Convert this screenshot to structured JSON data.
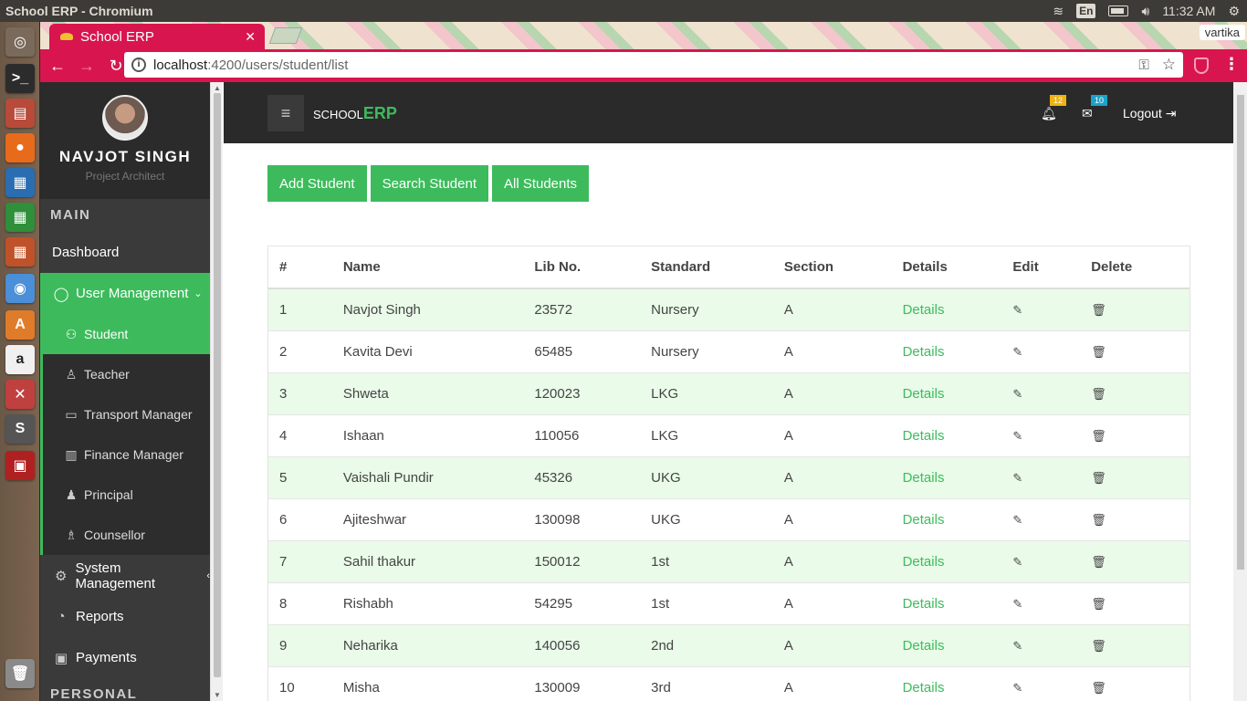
{
  "os": {
    "window_title": "School ERP - Chromium",
    "lang": "En",
    "time": "11:32 AM"
  },
  "launcher": [
    {
      "name": "dash-icon",
      "glyph": "◎",
      "color": "#7a6a5c"
    },
    {
      "name": "terminal-icon",
      "glyph": ">_",
      "color": "#2c2c2c"
    },
    {
      "name": "files-icon",
      "glyph": "▤",
      "color": "#b84a3a"
    },
    {
      "name": "firefox-icon",
      "glyph": "●",
      "color": "#e86b1c"
    },
    {
      "name": "writer-icon",
      "glyph": "▦",
      "color": "#2a6db0"
    },
    {
      "name": "calc-icon",
      "glyph": "▦",
      "color": "#2f8f3a"
    },
    {
      "name": "impress-icon",
      "glyph": "▦",
      "color": "#c0522a"
    },
    {
      "name": "chromium-icon",
      "glyph": "◉",
      "color": "#4a8fd8"
    },
    {
      "name": "software-center-icon",
      "glyph": "A",
      "color": "#e07b2a"
    },
    {
      "name": "amazon-icon",
      "glyph": "a",
      "color": "#f0f0f0"
    },
    {
      "name": "settings-tools-icon",
      "glyph": "✕",
      "color": "#c04040"
    },
    {
      "name": "sublime-icon",
      "glyph": "S",
      "color": "#555"
    },
    {
      "name": "workspace-icon",
      "glyph": "▣",
      "color": "#b02020"
    },
    {
      "name": "trash-icon",
      "glyph": "🗑",
      "color": "#8a8a8a"
    }
  ],
  "browser": {
    "tab_title": "School ERP",
    "url_host": "localhost",
    "url_path": ":4200/users/student/list",
    "profile": "vartika"
  },
  "sidebar": {
    "user_name": "NAVJOT SINGH",
    "user_role": "Project Architect",
    "main_heading": "MAIN",
    "dashboard": "Dashboard",
    "user_management": "User Management",
    "sub_items": [
      {
        "label": "Student",
        "icon": "users-icon"
      },
      {
        "label": "Teacher",
        "icon": "teacher-icon"
      },
      {
        "label": "Transport Manager",
        "icon": "bus-icon"
      },
      {
        "label": "Finance Manager",
        "icon": "bar-chart-icon"
      },
      {
        "label": "Principal",
        "icon": "user-tie-icon"
      },
      {
        "label": "Counsellor",
        "icon": "counsellor-icon"
      }
    ],
    "system_management": "System Management",
    "reports": "Reports",
    "payments": "Payments",
    "personal_heading": "PERSONAL"
  },
  "header": {
    "brand_small": "SCHOOL",
    "brand_big": "ERP",
    "notifications_count": "12",
    "messages_count": "10",
    "logout": "Logout"
  },
  "actions": {
    "add": "Add Student",
    "search": "Search Student",
    "all": "All Students"
  },
  "table": {
    "headers": [
      "#",
      "Name",
      "Lib No.",
      "Standard",
      "Section",
      "Details",
      "Edit",
      "Delete"
    ],
    "rows": [
      [
        "1",
        "Navjot Singh",
        "23572",
        "Nursery",
        "A",
        "Details"
      ],
      [
        "2",
        "Kavita Devi",
        "65485",
        "Nursery",
        "A",
        "Details"
      ],
      [
        "3",
        "Shweta",
        "120023",
        "LKG",
        "A",
        "Details"
      ],
      [
        "4",
        "Ishaan",
        "110056",
        "LKG",
        "A",
        "Details"
      ],
      [
        "5",
        "Vaishali Pundir",
        "45326",
        "UKG",
        "A",
        "Details"
      ],
      [
        "6",
        "Ajiteshwar",
        "130098",
        "UKG",
        "A",
        "Details"
      ],
      [
        "7",
        "Sahil thakur",
        "150012",
        "1st",
        "A",
        "Details"
      ],
      [
        "8",
        "Rishabh",
        "54295",
        "1st",
        "A",
        "Details"
      ],
      [
        "9",
        "Neharika",
        "140056",
        "2nd",
        "A",
        "Details"
      ],
      [
        "10",
        "Misha",
        "130009",
        "3rd",
        "A",
        "Details"
      ]
    ]
  }
}
